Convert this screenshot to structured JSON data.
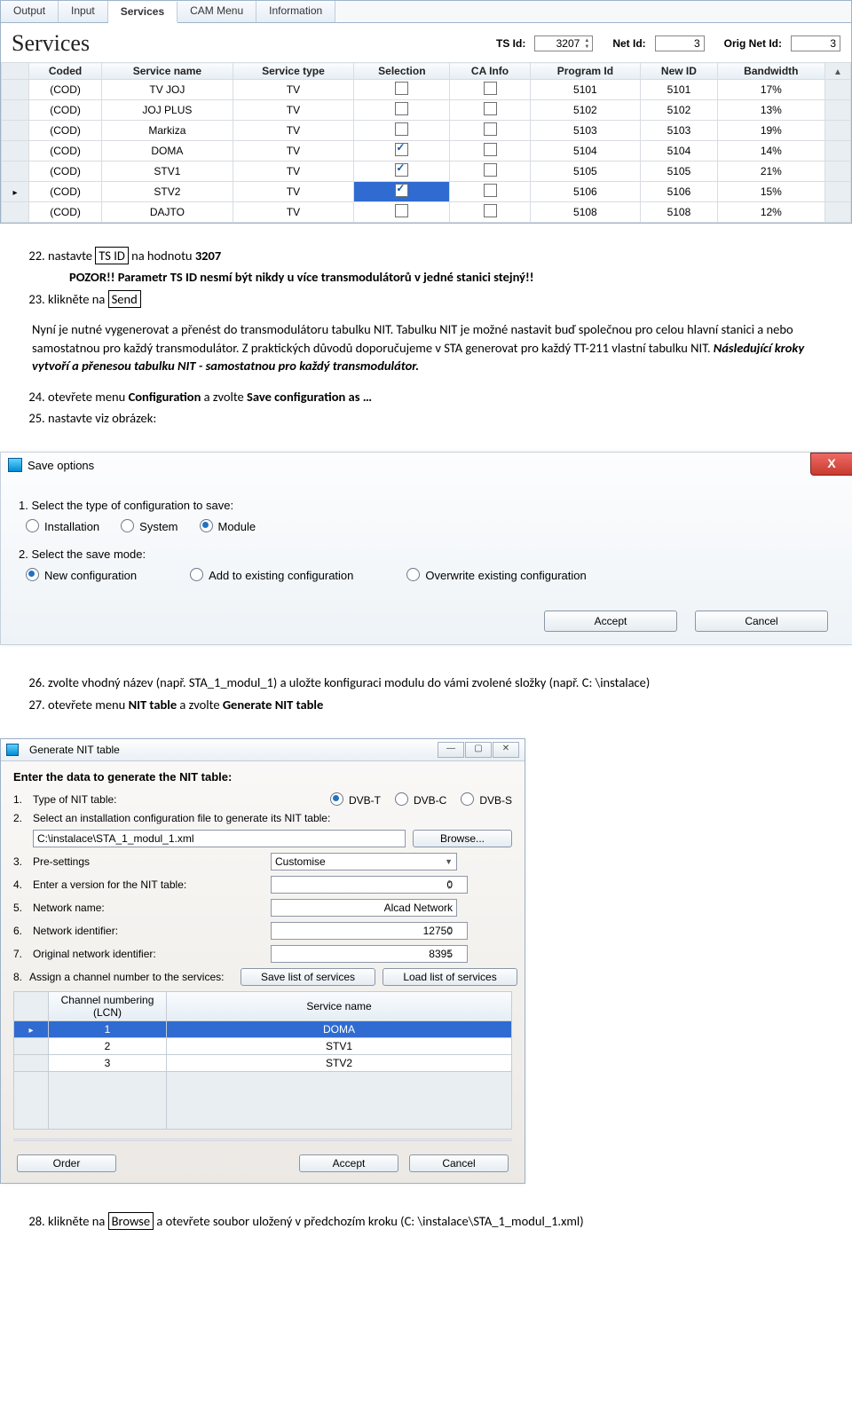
{
  "services_panel": {
    "tabs": [
      "Output",
      "Input",
      "Services",
      "CAM Menu",
      "Information"
    ],
    "active_tab": 2,
    "title": "Services",
    "fields": {
      "ts_id_label": "TS Id:",
      "ts_id_value": "3207",
      "net_id_label": "Net Id:",
      "net_id_value": "3",
      "orig_net_id_label": "Orig Net Id:",
      "orig_net_id_value": "3"
    },
    "columns": [
      "Coded",
      "Service name",
      "Service type",
      "Selection",
      "CA Info",
      "Program Id",
      "New ID",
      "Bandwidth"
    ],
    "rows": [
      {
        "coded": "(COD)",
        "name": "TV JOJ",
        "type": "TV",
        "sel": false,
        "ca": false,
        "pid": "5101",
        "nid": "5101",
        "bw": "17%",
        "current": false,
        "hl": false
      },
      {
        "coded": "(COD)",
        "name": "JOJ PLUS",
        "type": "TV",
        "sel": false,
        "ca": false,
        "pid": "5102",
        "nid": "5102",
        "bw": "13%",
        "current": false,
        "hl": false
      },
      {
        "coded": "(COD)",
        "name": "Markiza",
        "type": "TV",
        "sel": false,
        "ca": false,
        "pid": "5103",
        "nid": "5103",
        "bw": "19%",
        "current": false,
        "hl": false
      },
      {
        "coded": "(COD)",
        "name": "DOMA",
        "type": "TV",
        "sel": true,
        "ca": false,
        "pid": "5104",
        "nid": "5104",
        "bw": "14%",
        "current": false,
        "hl": false
      },
      {
        "coded": "(COD)",
        "name": "STV1",
        "type": "TV",
        "sel": true,
        "ca": false,
        "pid": "5105",
        "nid": "5105",
        "bw": "21%",
        "current": false,
        "hl": false
      },
      {
        "coded": "(COD)",
        "name": "STV2",
        "type": "TV",
        "sel": true,
        "ca": false,
        "pid": "5106",
        "nid": "5106",
        "bw": "15%",
        "current": true,
        "hl": true
      },
      {
        "coded": "(COD)",
        "name": "DAJTO",
        "type": "TV",
        "sel": false,
        "ca": false,
        "pid": "5108",
        "nid": "5108",
        "bw": "12%",
        "current": false,
        "hl": false
      }
    ]
  },
  "doc": {
    "step22_a": "nastavte ",
    "step22_box": "TS ID",
    "step22_b": " na hodnotu ",
    "step22_val": "3207",
    "pozor": "POZOR!! Parametr TS ID nesmí být nikdy u více transmodulátorů v jedné stanici stejný!!",
    "step23_a": "klikněte na ",
    "step23_box": "Send",
    "para1": "Nyní je nutné vygenerovat a přenést do transmodulátoru tabulku NIT. Tabulku NIT je možné nastavit buď společnou pro celou hlavní stanici a nebo samostatnou pro každý transmodulátor. Z praktických důvodů doporučujeme v STA generovat pro každý TT-211 vlastní tabulku NIT. ",
    "para1_ital": "Následující kroky vytvoří a přenesou tabulku NIT - samostatnou pro každý transmodulátor.",
    "step24_a": "otevřete menu ",
    "step24_b": "Configuration",
    "step24_c": " a zvolte ",
    "step24_d": "Save configuration as …",
    "step25": "nastavte viz obrázek:",
    "step26": "zvolte vhodný název (např. STA_1_modul_1) a uložte konfiguraci modulu do vámi zvolené složky (např. C: \\instalace)",
    "step27_a": "otevřete menu ",
    "step27_b": "NIT table",
    "step27_c": " a zvolte ",
    "step27_d": "Generate NIT table",
    "step28_a": "klikněte na ",
    "step28_box": "Browse",
    "step28_b": " a otevřete soubor uložený v předchozím kroku (C: \\instalace\\STA_1_modul_1.xml)"
  },
  "save_dialog": {
    "title": "Save options",
    "q1": "1. Select the type of configuration to save:",
    "opt1": [
      "Installation",
      "System",
      "Module"
    ],
    "opt1_selected": 2,
    "q2": "2. Select the save mode:",
    "opt2": [
      "New configuration",
      "Add to existing configuration",
      "Overwrite existing configuration"
    ],
    "opt2_selected": 0,
    "btn_accept": "Accept",
    "btn_cancel": "Cancel"
  },
  "nit_dialog": {
    "title": "Generate NIT table",
    "lead": "Enter the data to generate the NIT table:",
    "row1_label": "Type of NIT table:",
    "row1_opts": [
      "DVB-T",
      "DVB-C",
      "DVB-S"
    ],
    "row1_selected": 0,
    "row2_label": "Select an installation configuration file to generate its NIT table:",
    "file_path": "C:\\instalace\\STA_1_modul_1.xml",
    "btn_browse": "Browse...",
    "row3_label": "Pre-settings",
    "row3_value": "Customise",
    "row4_label": "Enter a version for the NIT table:",
    "row4_value": "0",
    "row5_label": "Network name:",
    "row5_value": "Alcad Network",
    "row6_label": "Network identifier:",
    "row6_value": "12750",
    "row7_label": "Original network identifier:",
    "row7_value": "8395",
    "row8_label": "Assign a channel number to the services:",
    "btn_save_list": "Save list of services",
    "btn_load_list": "Load list of services",
    "lcn": {
      "col1": "Channel numbering (LCN)",
      "col2": "Service name",
      "rows": [
        {
          "lcn": "1",
          "name": "DOMA",
          "hl": true,
          "current": true
        },
        {
          "lcn": "2",
          "name": "STV1",
          "hl": false,
          "current": false
        },
        {
          "lcn": "3",
          "name": "STV2",
          "hl": false,
          "current": false
        }
      ]
    },
    "btn_order": "Order",
    "btn_accept": "Accept",
    "btn_cancel": "Cancel"
  }
}
